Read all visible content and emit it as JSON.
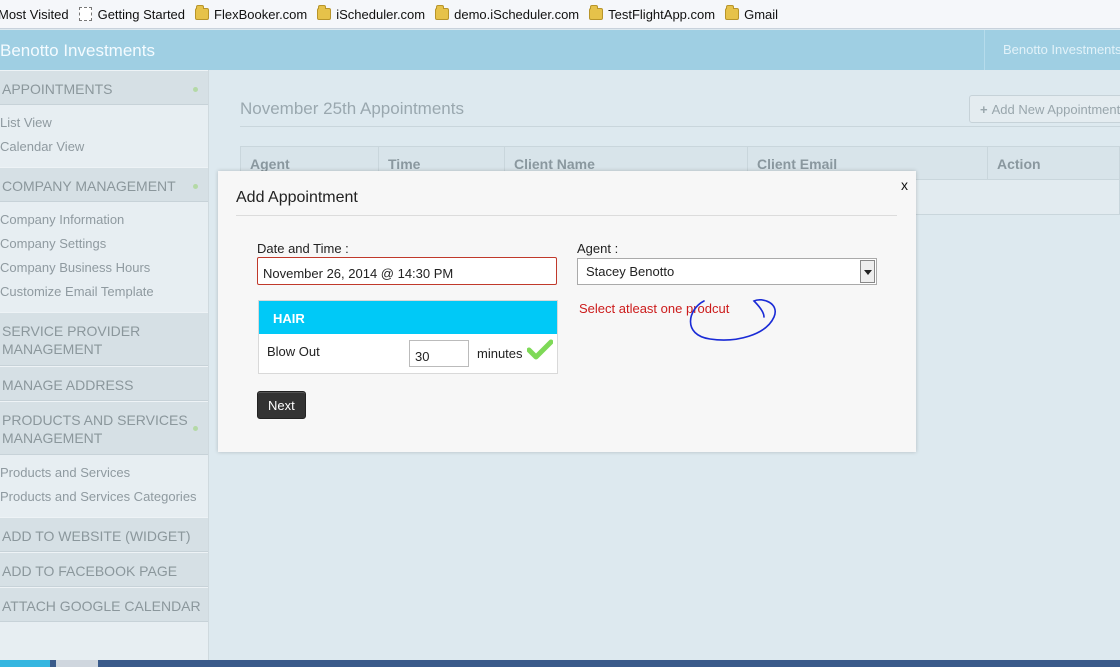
{
  "bookmarks": [
    {
      "label": "Most Visited",
      "icon": "none"
    },
    {
      "label": "Getting Started",
      "icon": "page-icon"
    },
    {
      "label": "FlexBooker.com",
      "icon": "folder-icon"
    },
    {
      "label": "iScheduler.com",
      "icon": "folder-icon"
    },
    {
      "label": "demo.iScheduler.com",
      "icon": "folder-icon"
    },
    {
      "label": "TestFlightApp.com",
      "icon": "folder-icon"
    },
    {
      "label": "Gmail",
      "icon": "folder-icon"
    }
  ],
  "header": {
    "brand": "Benotto Investments",
    "account": "Benotto Investments"
  },
  "sidebar": {
    "appointments": {
      "title": "APPOINTMENTS",
      "items": [
        "List View",
        "Calendar View"
      ]
    },
    "company": {
      "title": "COMPANY MANAGEMENT",
      "items": [
        "Company Information",
        "Company Settings",
        "Company Business Hours",
        "Customize Email Template"
      ]
    },
    "service_provider": {
      "title": "SERVICE PROVIDER MANAGEMENT"
    },
    "manage_address": {
      "title": "MANAGE ADDRESS"
    },
    "products": {
      "title": "PRODUCTS AND SERVICES MANAGEMENT",
      "items": [
        "Products and Services",
        "Products and Services Categories"
      ]
    },
    "widget": {
      "title": "ADD TO WEBSITE (WIDGET)"
    },
    "facebook": {
      "title": "ADD TO FACEBOOK PAGE"
    },
    "google": {
      "title": "ATTACH GOOGLE CALENDAR"
    }
  },
  "main": {
    "title": "November 25th Appointments",
    "add_button": "Add New Appointment",
    "columns": [
      "Agent",
      "Time",
      "Client Name",
      "Client Email",
      "Action"
    ]
  },
  "modal": {
    "title": "Add Appointment",
    "close": "x",
    "date_label": "Date and Time :",
    "date_value": "November 26, 2014 @ 14:30 PM",
    "agent_label": "Agent :",
    "agent_value": "Stacey Benotto",
    "error": "Select atleast one prodcut",
    "category": "HAIR",
    "product": "Blow Out",
    "duration": "30",
    "duration_unit": "minutes",
    "next": "Next"
  },
  "colors": {
    "header": "#9fcfe3",
    "category_bar": "#00c9f7",
    "error": "#cc1b1b",
    "check": "#7ed957"
  }
}
